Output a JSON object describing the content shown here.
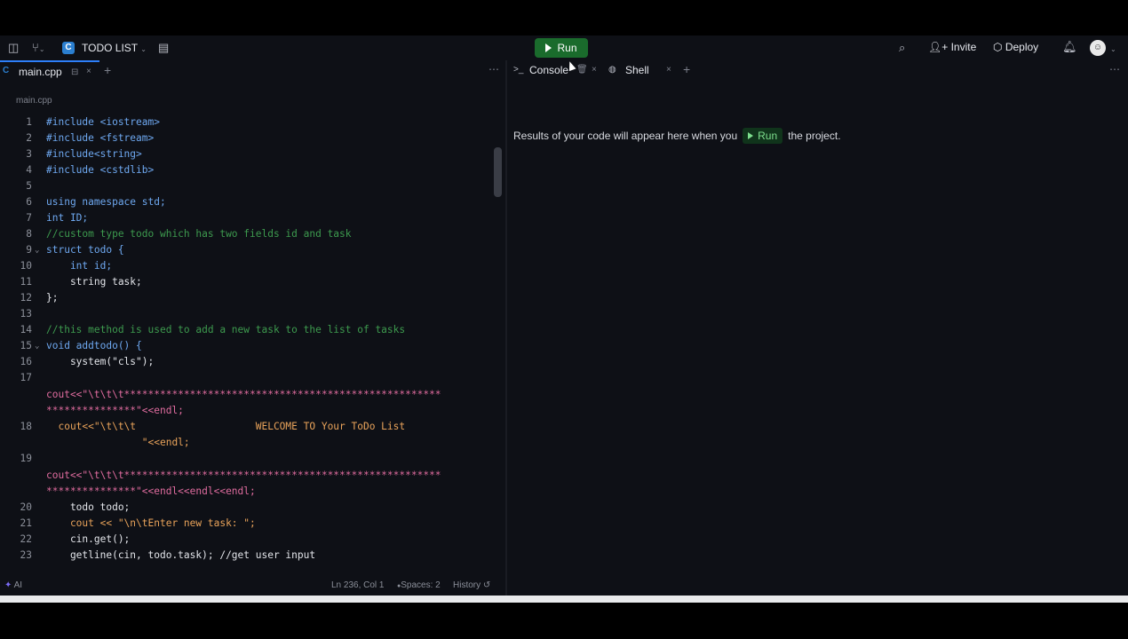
{
  "topbar": {
    "repl_name": "TODO LIST",
    "run_label": "Run",
    "invite_label": "Invite",
    "deploy_label": "Deploy"
  },
  "editor": {
    "tab_label": "main.cpp",
    "breadcrumb": "main.cpp",
    "lines": [
      {
        "n": "1"
      },
      {
        "n": "2"
      },
      {
        "n": "3"
      },
      {
        "n": "4"
      },
      {
        "n": "5"
      },
      {
        "n": "6"
      },
      {
        "n": "7"
      },
      {
        "n": "8"
      },
      {
        "n": "9"
      },
      {
        "n": "10"
      },
      {
        "n": "11"
      },
      {
        "n": "12"
      },
      {
        "n": "13"
      },
      {
        "n": "14"
      },
      {
        "n": "15"
      },
      {
        "n": "16"
      },
      {
        "n": "17"
      },
      {
        "n": "18"
      },
      {
        "n": "19"
      },
      {
        "n": "20"
      },
      {
        "n": "21"
      },
      {
        "n": "22"
      },
      {
        "n": "23"
      }
    ],
    "code": {
      "l1": "#include <iostream>",
      "l2": "#include <fstream>",
      "l3": "#include<string>",
      "l4": "#include <cstdlib>",
      "l6": "using namespace std;",
      "l7": "int ID;",
      "l8": "//custom type todo which has two fields id and task",
      "l9": "struct todo {",
      "l10": "    int id;",
      "l11": "    string task;",
      "l12": "};",
      "l14": "//this method is used to add a new task to the list of tasks",
      "l15": "void addtodo() {",
      "l16": "    system(\"cls\");",
      "l17a": "cout<<\"\\t\\t\\t*****************************************************",
      "l17b": "***************\"<<endl;",
      "l18a": "  cout<<\"\\t\\t\\t                    WELCOME TO Your ToDo List",
      "l18b": "                \"<<endl;",
      "l19a": "cout<<\"\\t\\t\\t*****************************************************",
      "l19b": "***************\"<<endl<<endl<<endl;",
      "l20": "    todo todo;",
      "l21": "    cout << \"\\n\\tEnter new task: \";",
      "l22": "    cin.get();",
      "l23": "    getline(cin, todo.task); //get user input"
    },
    "status": {
      "ai_label": "AI",
      "position": "Ln 236, Col 1",
      "spaces": "Spaces: 2",
      "history": "History"
    }
  },
  "console": {
    "tab_console": "Console",
    "tab_shell": "Shell",
    "msg_before": "Results of your code will appear here when you",
    "msg_run": "Run",
    "msg_after": "the project."
  }
}
